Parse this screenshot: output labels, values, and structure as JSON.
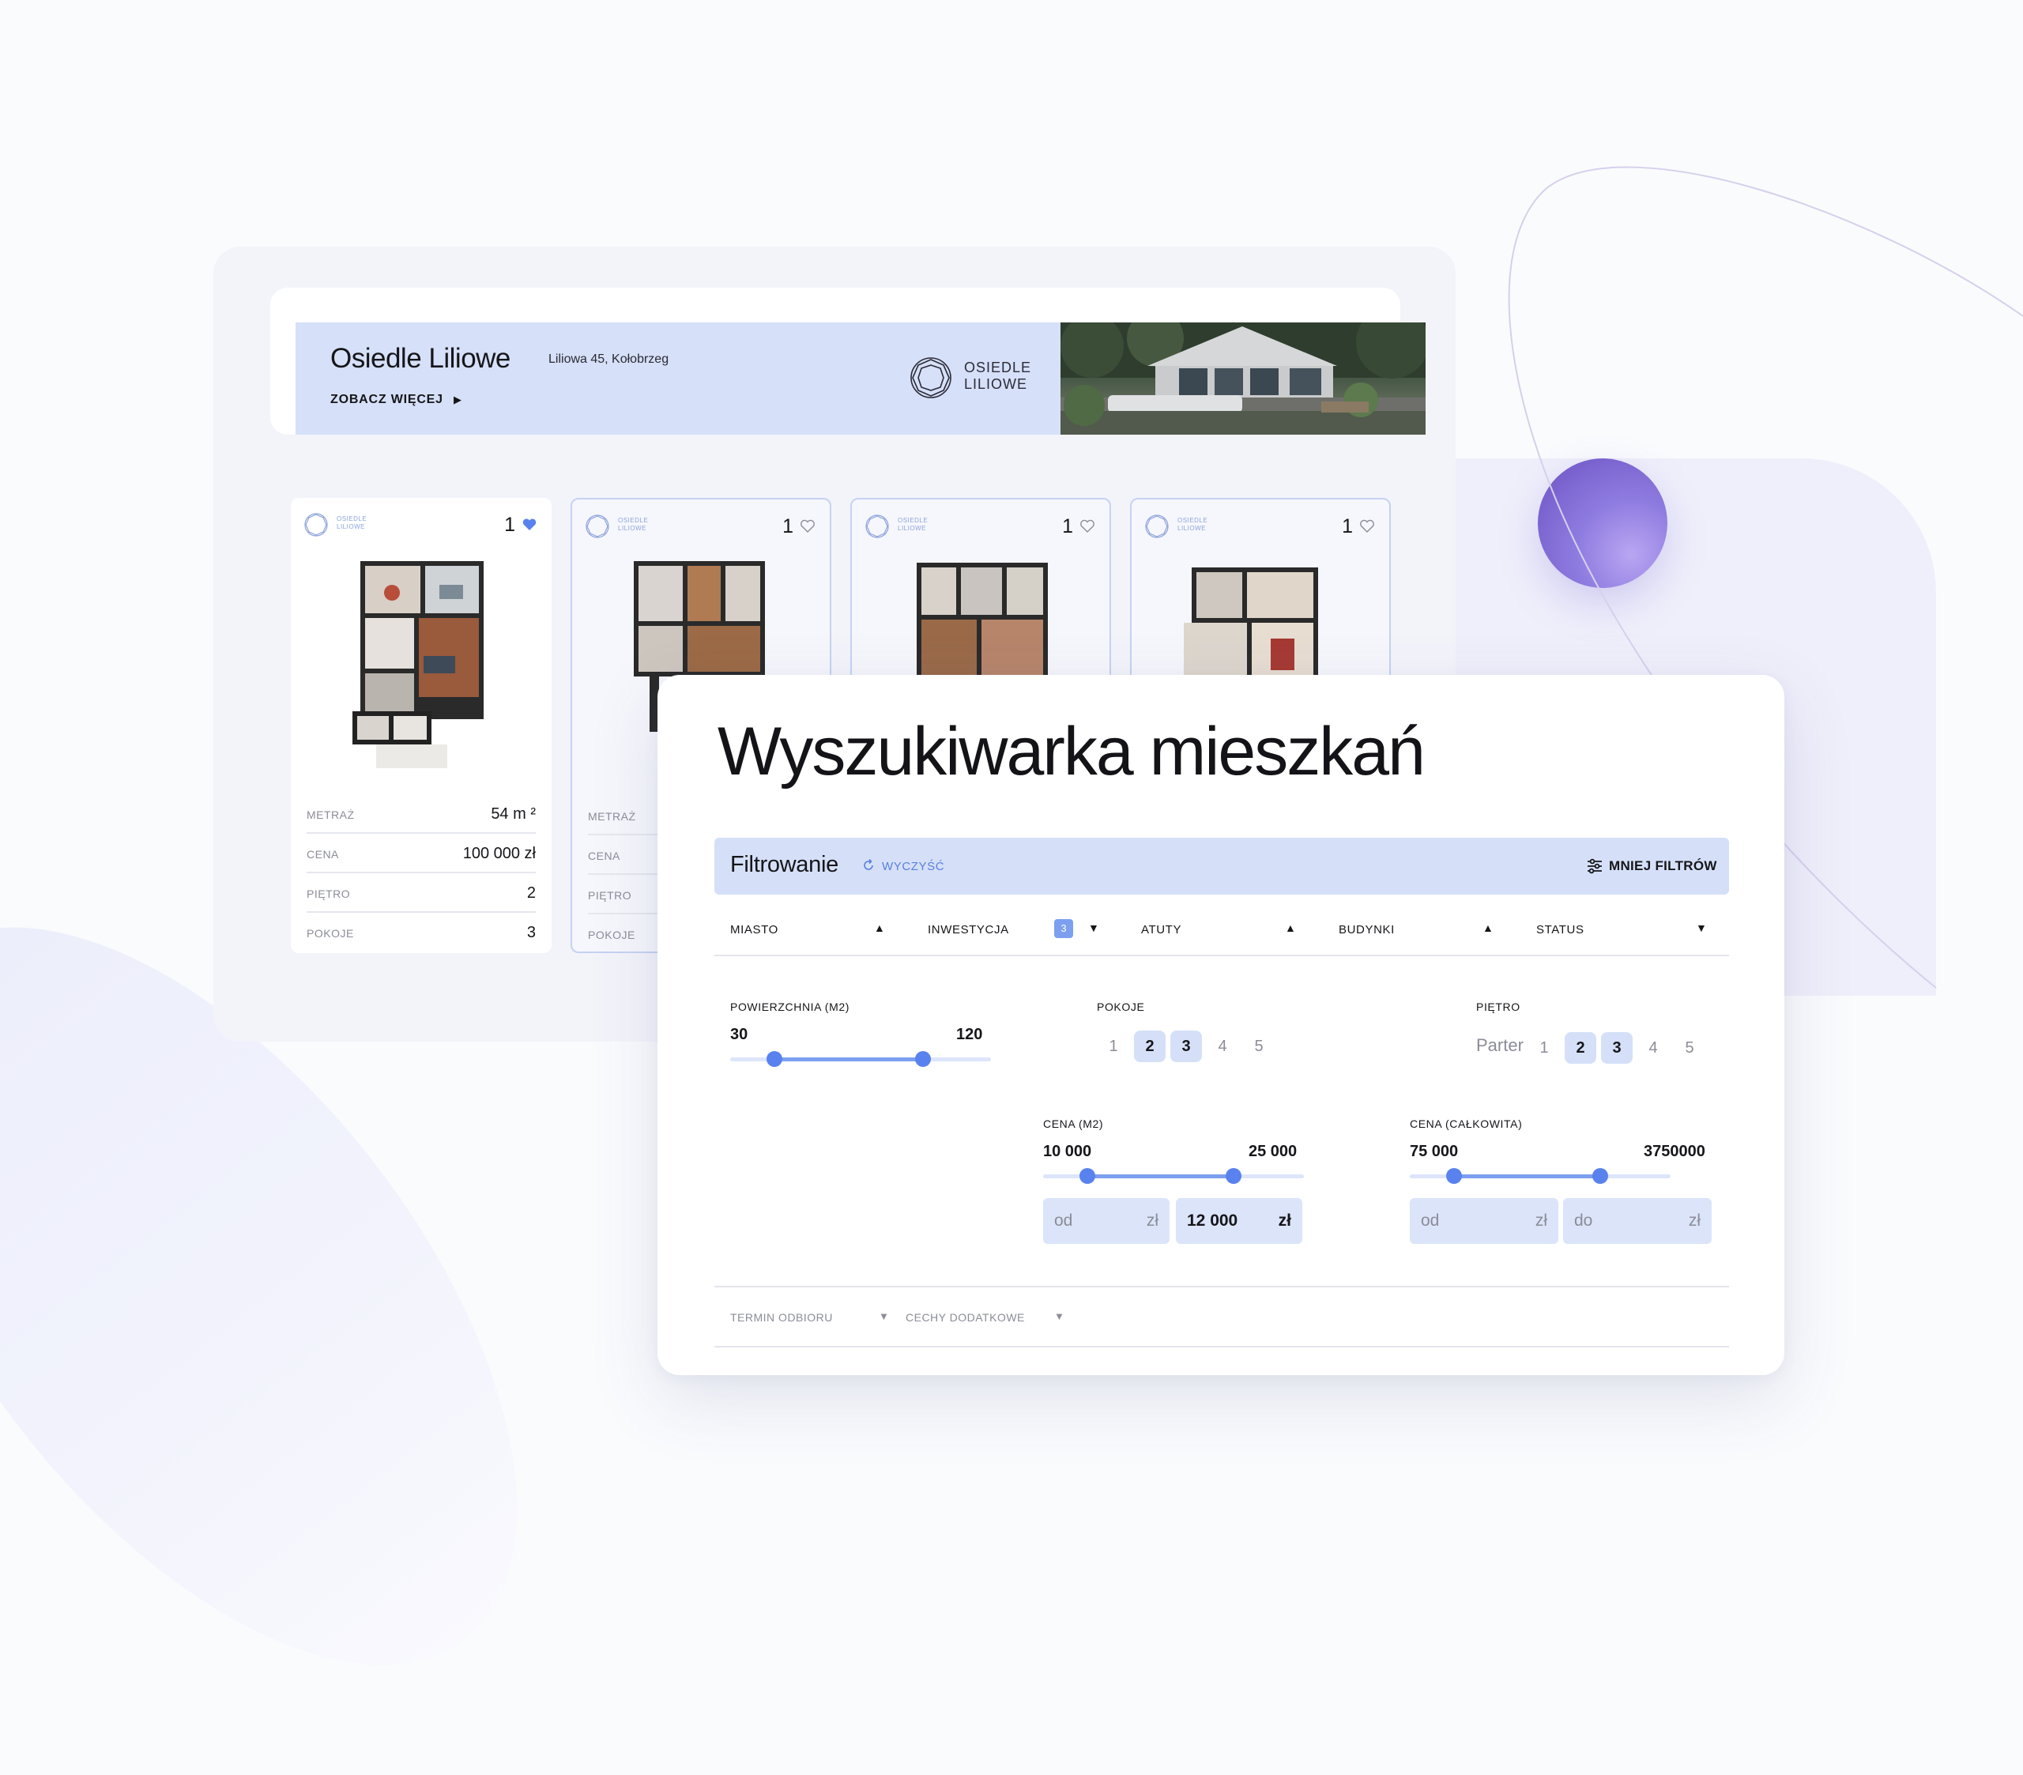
{
  "banner": {
    "title": "Osiedle Liliowe",
    "address": "Liliowa 45, Kołobrzeg",
    "more_label": "ZOBACZ WIĘCEJ",
    "more_arrow": "▶",
    "logo_text_line1": "OSIEDLE",
    "logo_text_line2": "LILIOWE"
  },
  "cards": [
    {
      "logo_line1": "OSIEDLE",
      "logo_line2": "LILIOWE",
      "count": "1",
      "favorited": true,
      "rows": [
        {
          "label": "METRAŻ",
          "value": "54 m ²"
        },
        {
          "label": "CENA",
          "value": "100 000 zł"
        },
        {
          "label": "PIĘTRO",
          "value": "2"
        },
        {
          "label": "POKOJE",
          "value": "3"
        }
      ]
    },
    {
      "logo_line1": "OSIEDLE",
      "logo_line2": "LILIOWE",
      "count": "1",
      "favorited": false,
      "rows": [
        {
          "label": "METRAŻ"
        },
        {
          "label": "CENA"
        },
        {
          "label": "PIĘTRO"
        },
        {
          "label": "POKOJE"
        }
      ]
    },
    {
      "logo_line1": "OSIEDLE",
      "logo_line2": "LILIOWE",
      "count": "1",
      "favorited": false
    },
    {
      "logo_line1": "OSIEDLE",
      "logo_line2": "LILIOWE",
      "count": "1",
      "favorited": false
    }
  ],
  "search": {
    "title": "Wyszukiwarka mieszkań",
    "filter_title": "Filtrowanie",
    "clear_label": "WYCZYŚĆ",
    "less_filters_label": "MNIEJ FILTRÓW",
    "dropdowns": [
      {
        "label": "MIASTO",
        "caret": "▲"
      },
      {
        "label": "INWESTYCJA",
        "badge": "3",
        "caret": "▼"
      },
      {
        "label": "ATUTY",
        "caret": "▲"
      },
      {
        "label": "BUDYNKI",
        "caret": "▲"
      },
      {
        "label": "STATUS",
        "caret": "▼"
      }
    ],
    "area": {
      "label": "POWIERZCHNIA (M2)",
      "min": "30",
      "max": "120",
      "range_fraction": [
        0.17,
        0.74
      ]
    },
    "rooms": {
      "label": "POKOJE",
      "options": [
        "1",
        "2",
        "3",
        "4",
        "5"
      ],
      "selected": [
        "2",
        "3"
      ]
    },
    "floor": {
      "label": "PIĘTRO",
      "options": [
        "Parter",
        "1",
        "2",
        "3",
        "4",
        "5"
      ],
      "selected": [
        "2",
        "3"
      ]
    },
    "price_m2": {
      "label": "CENA (M2)",
      "min": "10 000",
      "max": "25 000",
      "range_fraction": [
        0.17,
        0.73
      ],
      "from_placeholder": "od",
      "from_unit": "zł",
      "to_value": "12 000",
      "to_unit": "zł"
    },
    "price_total": {
      "label": "CENA (CAŁKOWITA)",
      "min": "75 000",
      "max": "3750000",
      "range_fraction": [
        0.17,
        0.73
      ],
      "from_placeholder": "od",
      "from_unit": "zł",
      "to_placeholder": "do",
      "to_unit": "zł"
    },
    "bottom_dropdowns": [
      {
        "label": "TERMIN ODBIORU",
        "caret": "▼"
      },
      {
        "label": "CECHY DODATKOWE",
        "caret": "▼"
      }
    ]
  },
  "colors": {
    "accent": "#5a82ee",
    "accent_soft": "#d5e0f8",
    "orb": "#8f7ce0"
  }
}
